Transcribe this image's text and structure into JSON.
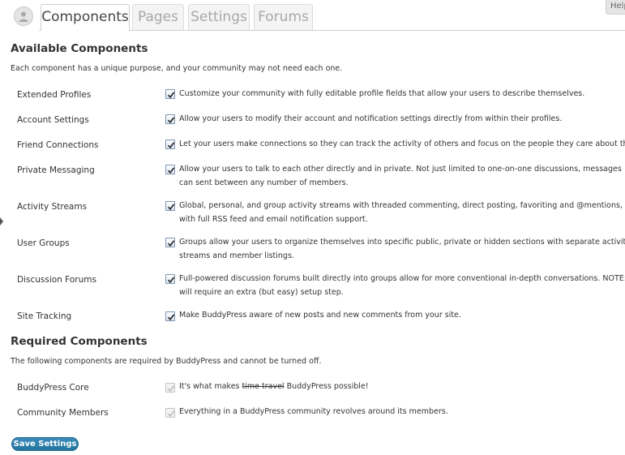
{
  "tabs": [
    {
      "label": "Components",
      "active": true
    },
    {
      "label": "Pages",
      "active": false
    },
    {
      "label": "Settings",
      "active": false
    },
    {
      "label": "Forums",
      "active": false
    }
  ],
  "help_label": "Help",
  "available": {
    "heading": "Available Components",
    "description": "Each component has a unique purpose, and your community may not need each one.",
    "components": [
      {
        "label": "Extended Profiles",
        "checked": true,
        "description": "Customize your community with fully editable profile fields that allow your users to describe themselves."
      },
      {
        "label": "Account Settings",
        "checked": true,
        "description": "Allow your users to modify their account and notification settings directly from within their profiles."
      },
      {
        "label": "Friend Connections",
        "checked": true,
        "description": "Let your users make connections so they can track the activity of others and focus on the people they care about the m"
      },
      {
        "label": "Private Messaging",
        "checked": true,
        "description": "Allow your users to talk to each other directly and in private. Not just limited to one-on-one discussions, messages can sent between any number of members."
      },
      {
        "label": "Activity Streams",
        "checked": true,
        "description": "Global, personal, and group activity streams with threaded commenting, direct posting, favoriting and @mentions, all with full RSS feed and email notification support."
      },
      {
        "label": "User Groups",
        "checked": true,
        "description": "Groups allow your users to organize themselves into specific public, private or hidden sections with separate activity streams and member listings."
      },
      {
        "label": "Discussion Forums",
        "checked": true,
        "description": "Full-powered discussion forums built directly into groups allow for more conventional in-depth conversations. NOTE: T will require an extra (but easy) setup step."
      },
      {
        "label": "Site Tracking",
        "checked": true,
        "description": "Make BuddyPress aware of new posts and new comments from your site."
      }
    ]
  },
  "required": {
    "heading": "Required Components",
    "description": "The following components are required by BuddyPress and cannot be turned off.",
    "core": {
      "label": "BuddyPress Core",
      "checked": true,
      "desc_before": "It's what makes ",
      "desc_strike": "time travel",
      "desc_after": " BuddyPress possible!"
    },
    "members": {
      "label": "Community Members",
      "checked": true,
      "description": "Everything in a BuddyPress community revolves around its members."
    }
  },
  "save_label": "Save Settings",
  "colors": {
    "accent": "#21759b",
    "checkbox_border": "#7d95b3",
    "checkmark": "#2b2b2b",
    "disabled_checkmark": "#bdbdbd"
  }
}
